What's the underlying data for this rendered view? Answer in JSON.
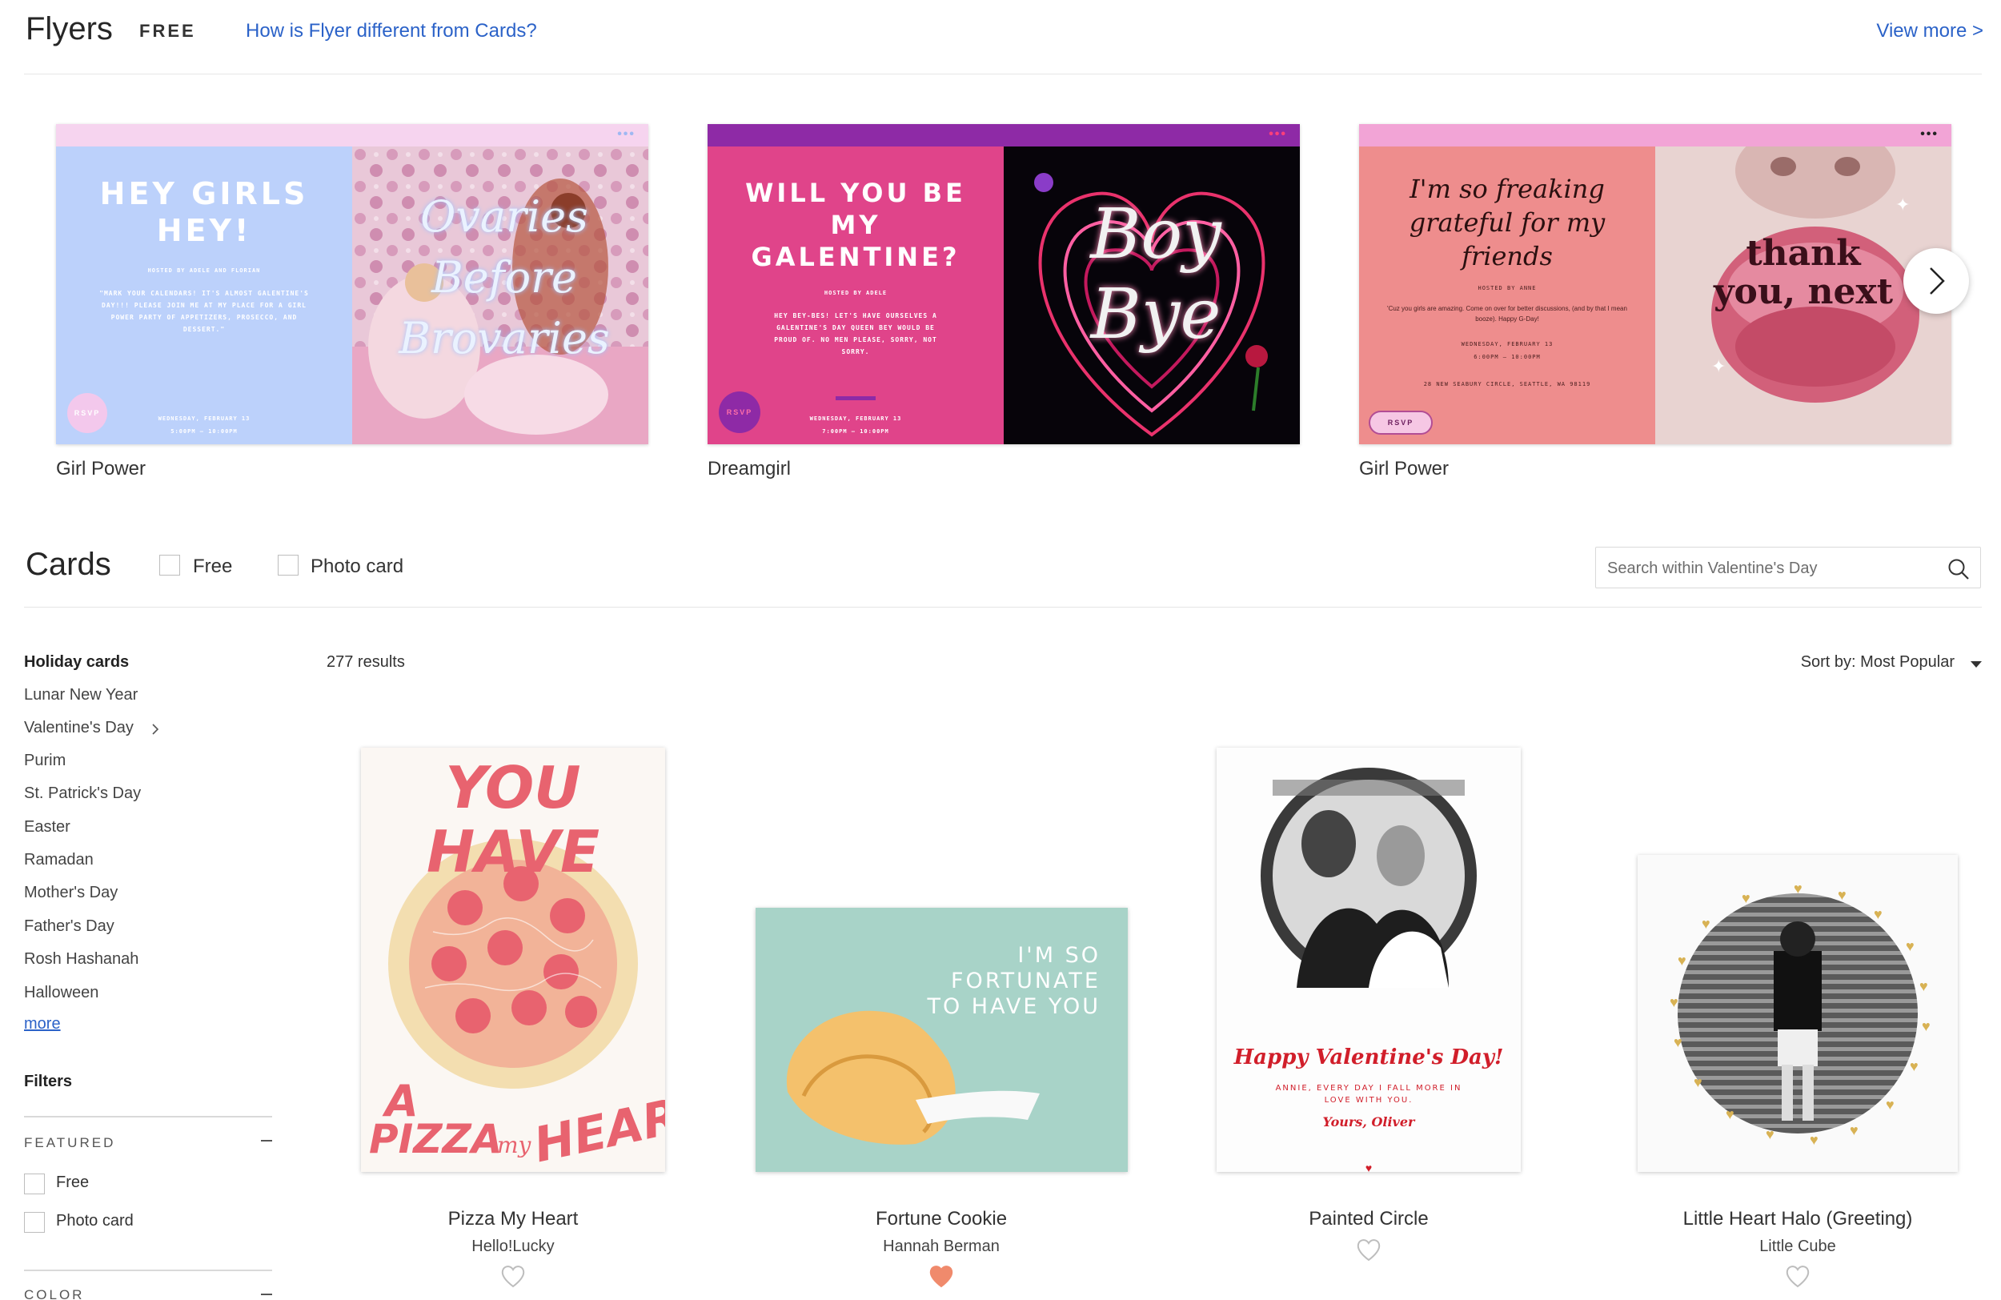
{
  "flyers": {
    "title": "Flyers",
    "badge": "FREE",
    "compare_link": "How is Flyer different from Cards?",
    "view_more": "View more >",
    "items": [
      {
        "name": "Girl Power",
        "bar_color": "#f6d4ef",
        "headline": "HEY GIRLS HEY!",
        "hosted": "HOSTED BY ADELE AND FLORIAN",
        "body": "\"MARK YOUR CALENDARS! IT'S ALMOST GALENTINE'S DAY!!! PLEASE JOIN ME AT MY PLACE FOR A GIRL POWER PARTY OF APPETIZERS, PROSECCO, AND DESSERT.\"",
        "date": "WEDNESDAY, FEBRUARY 13",
        "time": "5:00PM — 10:00PM",
        "rsvp": "RSVP",
        "overlay": "Ovaries Before Brovaries"
      },
      {
        "name": "Dreamgirl",
        "bar_color": "#8e2aa6",
        "headline": "WILL YOU BE MY GALENTINE?",
        "hosted": "HOSTED BY ADELE",
        "body": "HEY BEY-BES! LET'S HAVE OURSELVES A GALENTINE'S DAY QUEEN BEY WOULD BE PROUD OF. NO MEN PLEASE, SORRY, NOT SORRY.",
        "date": "WEDNESDAY, FEBRUARY 13",
        "time": "7:00PM — 10:00PM",
        "rsvp": "RSVP",
        "overlay": "Boy Bye"
      },
      {
        "name": "Girl Power",
        "bar_color": "#f2a4d6",
        "headline": "I'm so freaking grateful for my friends",
        "hosted": "HOSTED BY ANNE",
        "body": "'Cuz you girls are amazing. Come on over for better discussions, (and by that I mean booze). Happy G-Day!",
        "date": "WEDNESDAY, FEBRUARY 13",
        "time": "6:00PM — 10:00PM",
        "address": "28 NEW SEABURY CIRCLE, SEATTLE, WA 98119",
        "rsvp": "RSVP",
        "overlay": "thank you, next"
      }
    ]
  },
  "cards": {
    "title": "Cards",
    "filter_free": "Free",
    "filter_photo": "Photo card",
    "search_placeholder": "Search within Valentine's Day",
    "results": "277 results",
    "sort": "Sort by: Most Popular"
  },
  "sidebar": {
    "holiday_heading": "Holiday cards",
    "holidays": [
      "Lunar New Year",
      "Valentine's Day",
      "Purim",
      "St. Patrick's Day",
      "Easter",
      "Ramadan",
      "Mother's Day",
      "Father's Day",
      "Rosh Hashanah",
      "Halloween"
    ],
    "more": "more",
    "filters_heading": "Filters",
    "featured_caption": "FEATURED",
    "featured_options": [
      "Free",
      "Photo card"
    ],
    "color_caption": "COLOR"
  },
  "products": [
    {
      "title": "Pizza My Heart",
      "author": "Hello!Lucky",
      "art_top": "YOU HAVE",
      "art_bottom_a": "A",
      "art_bottom_b": "PIZZA",
      "art_bottom_c": "my",
      "art_bottom_d": "HEART",
      "favorited": false
    },
    {
      "title": "Fortune Cookie",
      "author": "Hannah Berman",
      "art_text": "I'M SO FORTUNATE TO HAVE YOU",
      "favorited": true
    },
    {
      "title": "Painted Circle",
      "author": "",
      "art_headline": "Happy Valentine's Day!",
      "art_body": "ANNIE, EVERY DAY I FALL MORE IN LOVE WITH YOU.",
      "art_sign": "Yours, Oliver",
      "favorited": false
    },
    {
      "title": "Little Heart Halo (Greeting)",
      "author": "Little Cube",
      "favorited": false
    }
  ],
  "colors": {
    "link": "#2b62c8",
    "heart_active": "#f08a6c",
    "heart_inactive": "#bdbdbd"
  }
}
